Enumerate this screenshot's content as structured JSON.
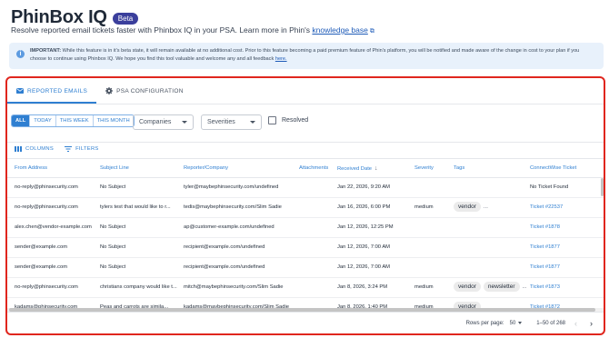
{
  "header": {
    "title": "PhinBox IQ",
    "badge": "Beta",
    "subtitle_text": "Resolve reported email tickets faster with Phinbox IQ in your PSA. Learn more in Phin's",
    "subtitle_link": "knowledge base"
  },
  "notice": {
    "label": "IMPORTANT:",
    "text": "While this feature is in it's beta state, it will remain available at no additional cost. Prior to this feature becoming a paid premium feature of Phin's platform, you will be notified and made aware of the change in cost to your plan if you choose to continue using Phinbox IQ. We hope you find this tool valuable and welcome any and all feedback",
    "link": "here."
  },
  "tabs": [
    {
      "label": "REPORTED EMAILS",
      "icon": "mail-icon",
      "active": true
    },
    {
      "label": "PSA CONFIGURATION",
      "icon": "gear-icon",
      "active": false
    }
  ],
  "filters": {
    "ranges": [
      "ALL",
      "TODAY",
      "THIS WEEK",
      "THIS MONTH"
    ],
    "active_range": "ALL",
    "companies_placeholder": "Companies",
    "severities_placeholder": "Severities",
    "resolved_label": "Resolved"
  },
  "toolbar": {
    "columns_label": "COLUMNS",
    "filters_label": "FILTERS"
  },
  "table": {
    "columns": [
      "From Address",
      "Subject Line",
      "Reporter/Company",
      "Attachments",
      "Received Date",
      "Severity",
      "Tags",
      "ConnectWise Ticket"
    ],
    "rows": [
      {
        "from": "no-reply@phinsecurity.com",
        "subject": "No Subject",
        "reporter": "tyler@maybephinsecurity.com/undefined",
        "attachments": "",
        "date": "Jan 22, 2026, 9:20 AM",
        "severity": "",
        "tags": [],
        "tags_more": "",
        "ticket": "No Ticket Found",
        "ticket_link": false
      },
      {
        "from": "no-reply@phinsecurity.com",
        "subject": "tylers test that would like to r...",
        "reporter": "tedis@maybephinsecurity.com/Slim Sadie",
        "attachments": "",
        "date": "Jan 16, 2026, 6:00 PM",
        "severity": "medium",
        "tags": [
          "vendor"
        ],
        "tags_more": "...",
        "ticket": "Ticket #22537",
        "ticket_link": true
      },
      {
        "from": "alex.chen@vendor-example.com",
        "subject": "No Subject",
        "reporter": "ap@customer-example.com/undefined",
        "attachments": "",
        "date": "Jan 12, 2026, 12:25 PM",
        "severity": "",
        "tags": [],
        "tags_more": "",
        "ticket": "Ticket #1878",
        "ticket_link": true
      },
      {
        "from": "sender@example.com",
        "subject": "No Subject",
        "reporter": "recipient@example.com/undefined",
        "attachments": "",
        "date": "Jan 12, 2026, 7:00 AM",
        "severity": "",
        "tags": [],
        "tags_more": "",
        "ticket": "Ticket #1877",
        "ticket_link": true
      },
      {
        "from": "sender@example.com",
        "subject": "No Subject",
        "reporter": "recipient@example.com/undefined",
        "attachments": "",
        "date": "Jan 12, 2026, 7:00 AM",
        "severity": "",
        "tags": [],
        "tags_more": "",
        "ticket": "Ticket #1877",
        "ticket_link": true
      },
      {
        "from": "no-reply@phinsecurity.com",
        "subject": "christians company would like t...",
        "reporter": "mitch@maybephinsecurity.com/Slim Sadie",
        "attachments": "",
        "date": "Jan 8, 2026, 3:24 PM",
        "severity": "medium",
        "tags": [
          "vendor",
          "newsletter"
        ],
        "tags_more": "...",
        "ticket": "Ticket #1873",
        "ticket_link": true
      },
      {
        "from": "kadams@phinsecurity.com",
        "subject": "Peas and carrots are simila...",
        "reporter": "kadams@maybephinsecurity.com/Slim Sadie",
        "attachments": "",
        "date": "Jan 8, 2026, 1:40 PM",
        "severity": "medium",
        "tags": [
          "vendor"
        ],
        "tags_more": "",
        "ticket": "Ticket #1872",
        "ticket_link": true
      }
    ]
  },
  "pagination": {
    "rows_per_page_label": "Rows per page:",
    "rows_per_page": "50",
    "range": "1–50 of 268"
  },
  "colors": {
    "accent": "#2f7fd1",
    "highlight_border": "#e0261e",
    "notice_bg": "#e8f1fb",
    "beta_bg": "#3b3f9c"
  }
}
